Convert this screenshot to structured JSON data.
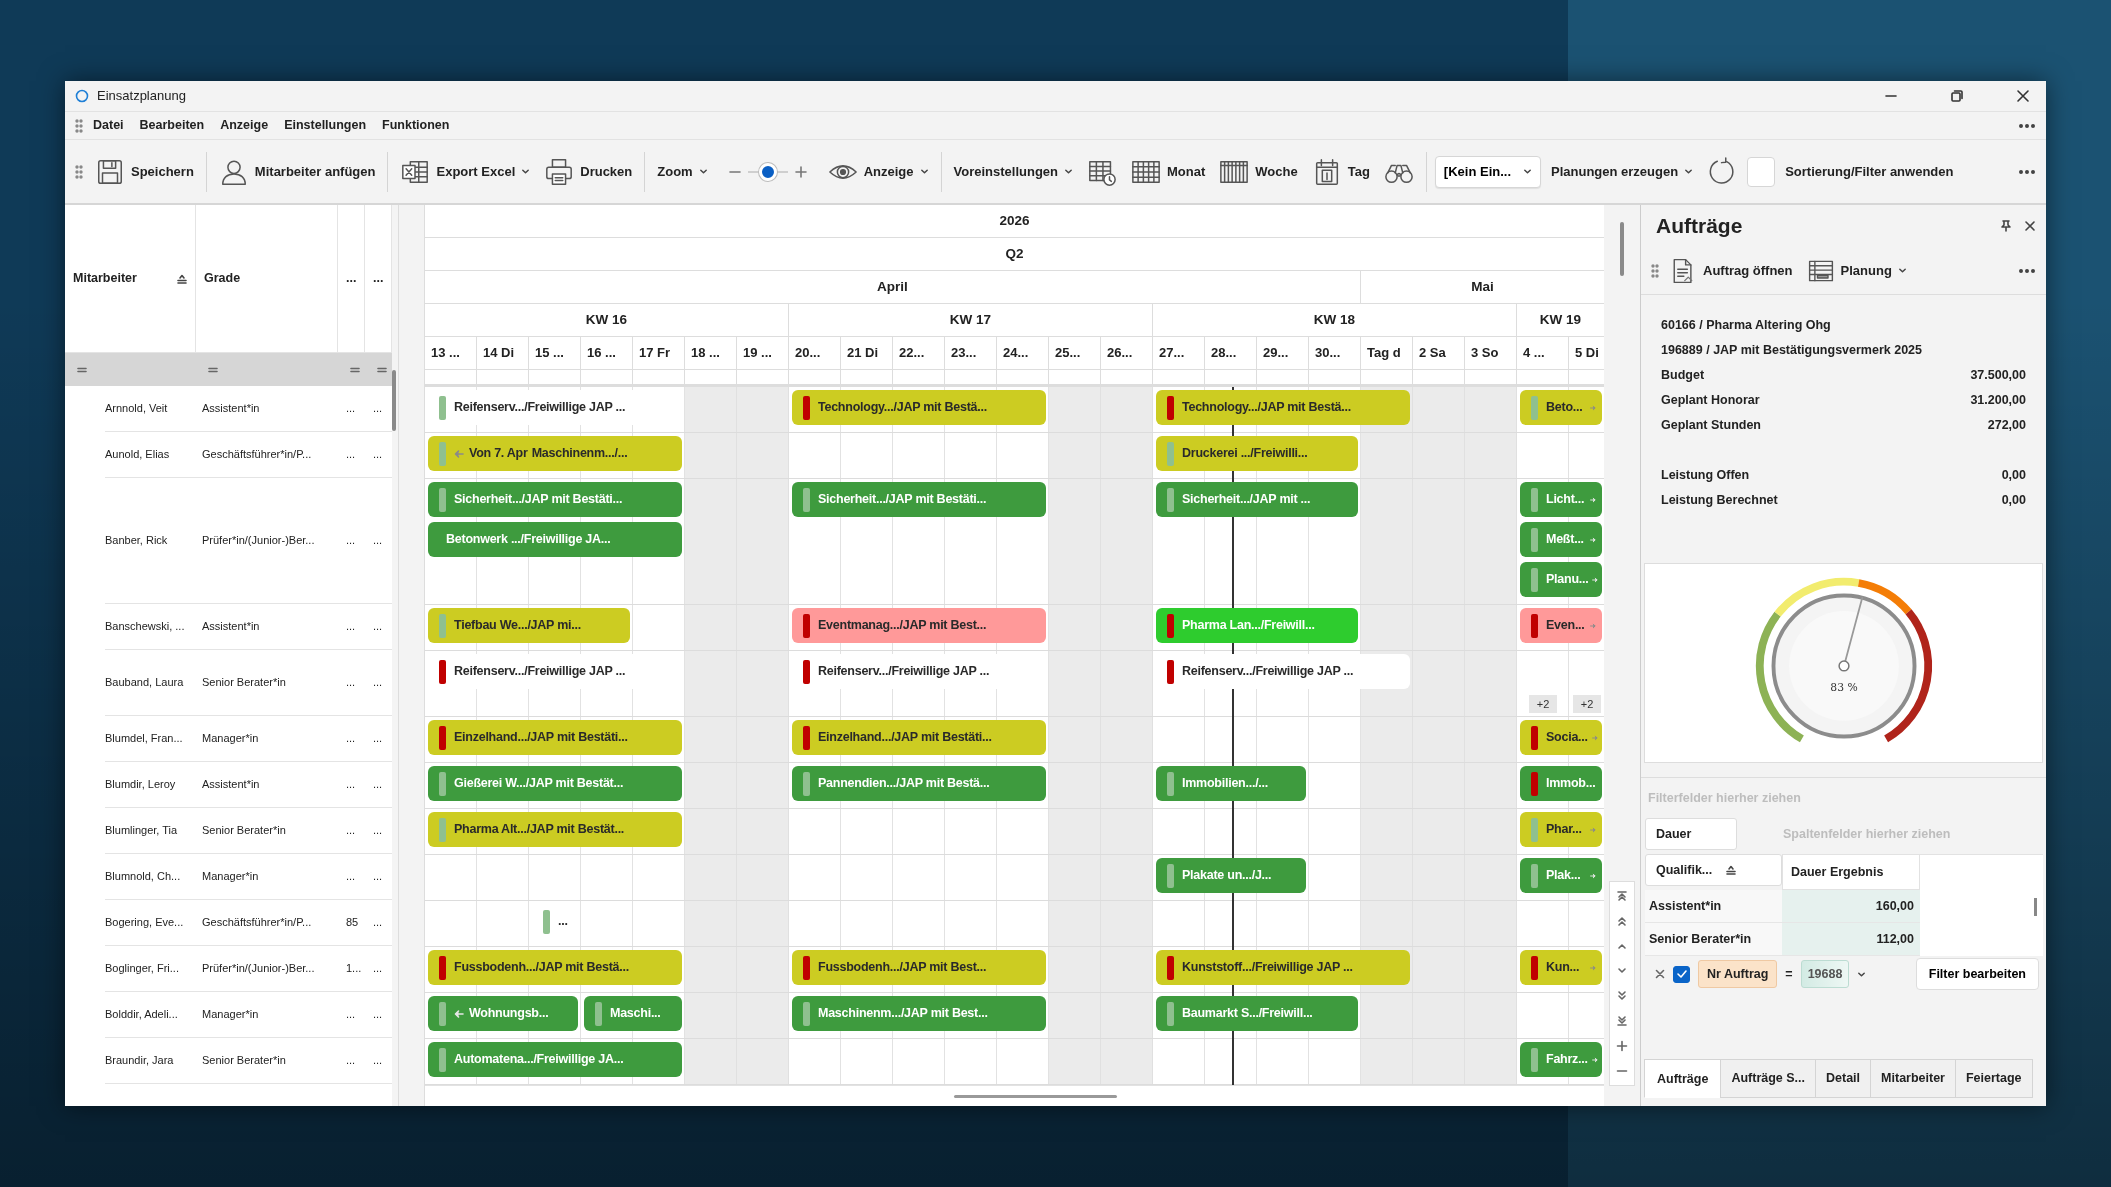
{
  "window": {
    "title": "Einsatzplanung"
  },
  "menu": [
    "Datei",
    "Bearbeiten",
    "Anzeige",
    "Einstellungen",
    "Funktionen"
  ],
  "toolbar": {
    "groups": [
      [
        {
          "kind": "button",
          "label": "Speichern"
        }
      ],
      [
        {
          "kind": "button",
          "label": "Mitarbeiter anfügen"
        }
      ],
      [
        {
          "kind": "dropdown",
          "label": "Export Excel"
        },
        {
          "kind": "button",
          "label": "Drucken"
        }
      ],
      [
        {
          "kind": "dropdown",
          "label": "Zoom"
        },
        {
          "kind": "slider",
          "level": 0.5
        },
        {
          "kind": "dropdown",
          "label": "Anzeige"
        }
      ],
      [
        {
          "kind": "dropdown",
          "label": "Voreinstellungen"
        },
        {
          "kind": "icon"
        },
        {
          "kind": "button",
          "label": "Monat"
        },
        {
          "kind": "button",
          "label": "Woche"
        },
        {
          "kind": "button",
          "label": "Tag"
        },
        {
          "kind": "icon"
        }
      ],
      [
        {
          "kind": "select",
          "value": "[Kein Ein..."
        },
        {
          "kind": "dropdown",
          "label": "Planungen erzeugen"
        },
        {
          "kind": "icon"
        },
        {
          "kind": "checkbox",
          "checked": false
        },
        {
          "kind": "button",
          "label": "Sortierung/Filter anwenden"
        }
      ]
    ]
  },
  "employee_grid": {
    "columns": [
      {
        "label": "Mitarbeiter",
        "sorted": true
      },
      {
        "label": "Grade",
        "sorted": false
      },
      {
        "label": "...",
        "sorted": false
      },
      {
        "label": "...",
        "sorted": false
      }
    ]
  },
  "calendar": {
    "year": "2026",
    "quarter": "Q2",
    "months": [
      "April",
      "Mai"
    ],
    "weeks": [
      "KW 16",
      "KW 17",
      "KW 18",
      "KW 19"
    ],
    "days": [
      {
        "label": "13 ...",
        "off": false
      },
      {
        "label": "14 Di",
        "off": false
      },
      {
        "label": "15 ...",
        "off": false
      },
      {
        "label": "16 ...",
        "off": false
      },
      {
        "label": "17 Fr",
        "off": false
      },
      {
        "label": "18 ...",
        "off": true
      },
      {
        "label": "19 ...",
        "off": true
      },
      {
        "label": "20...",
        "off": false
      },
      {
        "label": "21 Di",
        "off": false
      },
      {
        "label": "22...",
        "off": false
      },
      {
        "label": "23...",
        "off": false
      },
      {
        "label": "24...",
        "off": false
      },
      {
        "label": "25...",
        "off": true
      },
      {
        "label": "26...",
        "off": true
      },
      {
        "label": "27...",
        "off": false
      },
      {
        "label": "28...",
        "off": false
      },
      {
        "label": "29...",
        "off": false
      },
      {
        "label": "30...",
        "off": false
      },
      {
        "label": "Tag d",
        "off": true
      },
      {
        "label": "2 Sa",
        "off": true
      },
      {
        "label": "3 So",
        "off": true
      },
      {
        "label": "4 ...",
        "off": false
      },
      {
        "label": "5 Di",
        "off": false
      }
    ]
  },
  "employees": [
    {
      "name": "Arnnold, Veit",
      "grade": "Assistent*in",
      "column_3": "...",
      "column_4": "...",
      "bookings": [
        {
          "label": "Reifenserv.../Freiwillige JAP ...",
          "color": "#ffffff",
          "marker": {
            "color": "#8fc08f"
          },
          "continues_before": false,
          "continues_after": false
        },
        {
          "label": "Technology.../JAP mit Bestä...",
          "color": "#cccc22",
          "marker": {
            "color": "#c00000"
          },
          "continues_before": false,
          "continues_after": false
        },
        {
          "label": "Technology.../JAP mit Bestä...",
          "color": "#cccc22",
          "marker": {
            "color": "#c00000"
          },
          "continues_before": false,
          "continues_after": false
        },
        {
          "label": "Beto...",
          "color": "#cccc22",
          "marker": {
            "color": "#8fc08f"
          },
          "continues_before": false,
          "continues_after": true
        }
      ]
    },
    {
      "name": "Aunold, Elias",
      "grade": "Geschäftsführer*in/P...",
      "column_3": "...",
      "column_4": "...",
      "bookings": [
        {
          "prefix": "Von 7. Apr",
          "label": "Maschinenm.../...",
          "color": "#cccc22",
          "marker": {
            "color": "#8fc08f"
          },
          "continues_before": true,
          "continues_after": false
        },
        {
          "label": "Druckerei .../Freiwilli...",
          "color": "#cccc22",
          "marker": {
            "color": "#8fc08f"
          },
          "continues_before": false,
          "continues_after": false
        }
      ]
    },
    {
      "name": "Banber, Rick",
      "grade": "Prüfer*in/(Junior-)Ber...",
      "column_3": "...",
      "column_4": "...",
      "bookings": [
        {
          "label": "Sicherheit.../JAP mit Bestäti...",
          "color": "#3e9b3e",
          "marker": {
            "color": "#8fc08f"
          },
          "continues_before": false,
          "continues_after": false
        },
        {
          "label": "Sicherheit.../JAP mit Bestäti...",
          "color": "#3e9b3e",
          "marker": {
            "color": "#8fc08f"
          },
          "continues_before": false,
          "continues_after": false
        },
        {
          "label": "Sicherheit.../JAP mit ...",
          "color": "#3e9b3e",
          "marker": {
            "color": "#8fc08f"
          },
          "continues_before": false,
          "continues_after": false
        },
        {
          "label": "Licht...",
          "color": "#3e9b3e",
          "marker": {
            "color": "#8fc08f"
          },
          "continues_before": false,
          "continues_after": true
        },
        {
          "label": "Betonwerk .../Freiwillige JA...",
          "color": "#3e9b3e",
          "continues_before": false,
          "continues_after": false
        },
        {
          "label": "Meßt...",
          "color": "#3e9b3e",
          "marker": {
            "color": "#8fc08f"
          },
          "continues_before": false,
          "continues_after": true
        },
        {
          "label": "Planu...",
          "color": "#3e9b3e",
          "marker": {
            "color": "#8fc08f"
          },
          "continues_before": false,
          "continues_after": true
        }
      ]
    },
    {
      "name": "Banschewski, ...",
      "grade": "Assistent*in",
      "column_3": "...",
      "column_4": "...",
      "bookings": [
        {
          "label": "Tiefbau We.../JAP mi...",
          "color": "#cccc22",
          "marker": {
            "color": "#8fc08f"
          },
          "continues_before": false,
          "continues_after": false
        },
        {
          "label": "Eventmanag.../JAP mit Best...",
          "color": "#ff9999",
          "marker": {
            "color": "#c00000"
          },
          "continues_before": false,
          "continues_after": false
        },
        {
          "label": "Pharma Lan.../Freiwill...",
          "color": "#2ecc2e",
          "marker": {
            "color": "#c00000"
          },
          "continues_before": false,
          "continues_after": false
        },
        {
          "label": "Even...",
          "color": "#ff9999",
          "marker": {
            "color": "#c00000"
          },
          "continues_before": false,
          "continues_after": true
        }
      ]
    },
    {
      "name": "Bauband, Laura",
      "grade": "Senior Berater*in",
      "column_3": "...",
      "column_4": "...",
      "bookings": [
        {
          "label": "Reifenserv.../Freiwillige JAP ...",
          "color": "#ffffff",
          "marker": {
            "color": "#c00000"
          },
          "continues_before": false,
          "continues_after": false
        },
        {
          "label": "Reifenserv.../Freiwillige JAP ...",
          "color": "#ffffff",
          "marker": {
            "color": "#c00000"
          },
          "continues_before": false,
          "continues_after": false
        },
        {
          "label": "Reifenserv.../Freiwillige JAP ...",
          "color": "#ffffff",
          "marker": {
            "color": "#c00000"
          },
          "continues_before": false,
          "continues_after": false
        }
      ],
      "more": [
        "+2",
        "+2"
      ]
    },
    {
      "name": "Blumdel, Fran...",
      "grade": "Manager*in",
      "column_3": "...",
      "column_4": "...",
      "bookings": [
        {
          "label": "Einzelhand.../JAP mit Bestäti...",
          "color": "#cccc22",
          "marker": {
            "color": "#c00000"
          },
          "continues_before": false,
          "continues_after": false
        },
        {
          "label": "Einzelhand.../JAP mit Bestäti...",
          "color": "#cccc22",
          "marker": {
            "color": "#c00000"
          },
          "continues_before": false,
          "continues_after": false
        },
        {
          "label": "Socia...",
          "color": "#cccc22",
          "marker": {
            "color": "#c00000"
          },
          "continues_before": false,
          "continues_after": true
        }
      ]
    },
    {
      "name": "Blumdir, Leroy",
      "grade": "Assistent*in",
      "column_3": "...",
      "column_4": "...",
      "bookings": [
        {
          "label": "Gießerei W.../JAP mit Bestät...",
          "color": "#3e9b3e",
          "marker": {
            "color": "#8fc08f"
          },
          "continues_before": false,
          "continues_after": false
        },
        {
          "label": "Pannendien.../JAP mit Bestä...",
          "color": "#3e9b3e",
          "marker": {
            "color": "#8fc08f"
          },
          "continues_before": false,
          "continues_after": false
        },
        {
          "label": "Immobilien.../...",
          "color": "#3e9b3e",
          "marker": {
            "color": "#8fc08f"
          },
          "continues_before": false,
          "continues_after": false
        },
        {
          "label": "Immob...",
          "color": "#3e9b3e",
          "marker": {
            "color": "#c00000"
          },
          "continues_before": false,
          "continues_after": false
        }
      ]
    },
    {
      "name": "Blumlinger, Tia",
      "grade": "Senior Berater*in",
      "column_3": "...",
      "column_4": "...",
      "bookings": [
        {
          "label": "Pharma Alt.../JAP mit Bestät...",
          "color": "#cccc22",
          "marker": {
            "color": "#8fc08f"
          },
          "continues_before": false,
          "continues_after": false
        },
        {
          "label": "Phar...",
          "color": "#cccc22",
          "marker": {
            "color": "#8fc08f"
          },
          "continues_before": false,
          "continues_after": true
        }
      ]
    },
    {
      "name": "Blumnold, Ch...",
      "grade": "Manager*in",
      "column_3": "...",
      "column_4": "...",
      "bookings": [
        {
          "label": "Plakate un.../J...",
          "color": "#3e9b3e",
          "marker": {
            "color": "#8fc08f"
          },
          "continues_before": false,
          "continues_after": false
        },
        {
          "label": "Plak...",
          "color": "#3e9b3e",
          "marker": {
            "color": "#8fc08f"
          },
          "continues_before": false,
          "continues_after": true
        }
      ]
    },
    {
      "name": "Bogering, Eve...",
      "grade": "Geschäftsführer*in/P...",
      "column_3": "85",
      "column_4": "...",
      "bookings": [
        {
          "label": "...",
          "color": "#ffffff",
          "marker": {
            "color": "#8fc08f"
          },
          "continues_before": false,
          "continues_after": false
        }
      ]
    },
    {
      "name": "Boglinger, Fri...",
      "grade": "Prüfer*in/(Junior-)Ber...",
      "column_3": "1...",
      "column_4": "...",
      "bookings": [
        {
          "label": "Fussbodenh.../JAP mit Bestä...",
          "color": "#cccc22",
          "marker": {
            "color": "#c00000"
          },
          "continues_before": false,
          "continues_after": false
        },
        {
          "label": "Fussbodenh.../JAP mit Best...",
          "color": "#cccc22",
          "marker": {
            "color": "#c00000"
          },
          "continues_before": false,
          "continues_after": false
        },
        {
          "label": "Kunststoff.../Freiwillige JAP ...",
          "color": "#cccc22",
          "marker": {
            "color": "#c00000"
          },
          "continues_before": false,
          "continues_after": false
        },
        {
          "label": "Kun...",
          "color": "#cccc22",
          "marker": {
            "color": "#c00000"
          },
          "continues_before": false,
          "continues_after": true
        }
      ]
    },
    {
      "name": "Bolddir, Adeli...",
      "grade": "Manager*in",
      "column_3": "...",
      "column_4": "...",
      "bookings": [
        {
          "label": "Wohnungsb...",
          "color": "#3e9b3e",
          "marker": {
            "color": "#8fc08f"
          },
          "continues_before": true,
          "continues_after": false
        },
        {
          "label": "Maschi...",
          "color": "#3e9b3e",
          "marker": {
            "color": "#8fc08f"
          },
          "continues_before": false,
          "continues_after": false
        },
        {
          "label": "Maschinenm.../JAP mit Best...",
          "color": "#3e9b3e",
          "marker": {
            "color": "#8fc08f"
          },
          "continues_before": false,
          "continues_after": false
        },
        {
          "label": "Baumarkt S.../Freiwill...",
          "color": "#3e9b3e",
          "marker": {
            "color": "#8fc08f"
          },
          "continues_before": false,
          "continues_after": false
        }
      ]
    },
    {
      "name": "Braundir, Jara",
      "grade": "Senior Berater*in",
      "column_3": "...",
      "column_4": "...",
      "bookings": [
        {
          "label": "Automatena.../Freiwillige JA...",
          "color": "#3e9b3e",
          "marker": {
            "color": "#8fc08f"
          },
          "continues_before": false,
          "continues_after": false
        },
        {
          "label": "Fahrz...",
          "color": "#3e9b3e",
          "marker": {
            "color": "#8fc08f"
          },
          "continues_before": false,
          "continues_after": true
        }
      ]
    }
  ],
  "orders_panel": {
    "title": "Aufträge",
    "toolbar": [
      {
        "kind": "button",
        "label": "Auftrag öffnen"
      },
      {
        "kind": "dropdown",
        "label": "Planung"
      }
    ],
    "info": {
      "lines": [
        "60166 / Pharma Altering Ohg",
        "196889 / JAP mit Bestätigungsvermerk 2025"
      ],
      "field_groups": [
        [
          {
            "label": "Budget",
            "value": "37.500,00"
          },
          {
            "label": "Geplant Honorar",
            "value": "31.200,00"
          },
          {
            "label": "Geplant Stunden",
            "value": "272,00"
          }
        ],
        [
          {
            "label": "Leistung Offen",
            "value": "0,00"
          },
          {
            "label": "Leistung Berechnet",
            "value": "0,00"
          }
        ]
      ]
    },
    "gauge": {
      "level": 0.55,
      "reading": "83 %"
    },
    "pivot": {
      "filter_placeholder": "Filterfelder hierher ziehen",
      "data_field": "Dauer",
      "column_placeholder": "Spaltenfelder hierher ziehen",
      "row_field": {
        "label": "Qualifik...",
        "sorted": true
      },
      "value_header": "Dauer Ergebnis",
      "rows": [
        {
          "label": "Assistent*in",
          "value": "160,00"
        },
        {
          "label": "Senior Berater*in",
          "value": "112,00"
        }
      ]
    },
    "filter": {
      "enabled": true,
      "field": "Nr Auftrag",
      "operator": "=",
      "value": "19688",
      "edit_button": "Filter bearbeiten"
    },
    "tabs": [
      {
        "label": "Aufträge",
        "selected": true
      },
      {
        "label": "Aufträge S...",
        "selected": false
      },
      {
        "label": "Detail",
        "selected": false
      },
      {
        "label": "Mitarbeiter",
        "selected": false
      },
      {
        "label": "Feiertage",
        "selected": false
      }
    ]
  }
}
